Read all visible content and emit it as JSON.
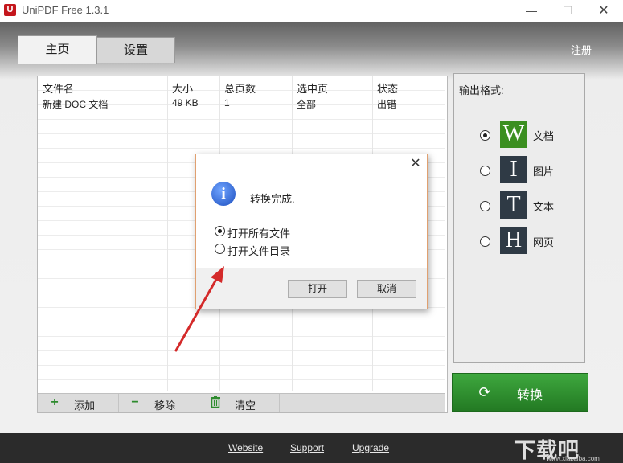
{
  "app": {
    "title": "UniPDF Free 1.3.1",
    "logo_letter": "U"
  },
  "window_controls": {
    "minimize": "—",
    "maximize": "☐",
    "close": "✕"
  },
  "tabs": [
    {
      "label": "主页",
      "active": true
    },
    {
      "label": "设置",
      "active": false
    }
  ],
  "register_label": "注册",
  "file_table": {
    "columns": [
      "文件名",
      "大小",
      "总页数",
      "选中页",
      "状态"
    ],
    "rows": [
      [
        "新建 DOC 文档",
        "49 KB",
        "1",
        "全部",
        "出错"
      ]
    ]
  },
  "file_actions": {
    "add": {
      "icon": "plus-icon",
      "label": "添加"
    },
    "remove": {
      "icon": "minus-icon",
      "label": "移除"
    },
    "clear": {
      "icon": "trash-icon",
      "label": "清空"
    }
  },
  "output_format": {
    "title": "输出格式:",
    "options": [
      {
        "icon_letter": "W",
        "label": "文档",
        "selected": true,
        "color": "#3b8f20"
      },
      {
        "icon_letter": "I",
        "label": "图片",
        "selected": false,
        "color": "#2f3a45"
      },
      {
        "icon_letter": "T",
        "label": "文本",
        "selected": false,
        "color": "#2f3a45"
      },
      {
        "icon_letter": "H",
        "label": "网页",
        "selected": false,
        "color": "#2f3a45"
      }
    ]
  },
  "convert_button": {
    "label": "转换",
    "icon": "refresh-icon"
  },
  "footer": {
    "links": [
      "Website",
      "Support",
      "Upgrade"
    ]
  },
  "watermark": {
    "text": "下载吧",
    "sub": "www.xiazaiba.com"
  },
  "dialog": {
    "message": "转换完成.",
    "options": [
      {
        "label": "打开所有文件",
        "selected": true
      },
      {
        "label": "打开文件目录",
        "selected": false
      }
    ],
    "buttons": {
      "open": "打开",
      "cancel": "取消"
    },
    "close": "✕",
    "info_glyph": "i"
  },
  "colors": {
    "accent_green": "#2f9a2f",
    "annotation_arrow": "#d42a2a"
  }
}
